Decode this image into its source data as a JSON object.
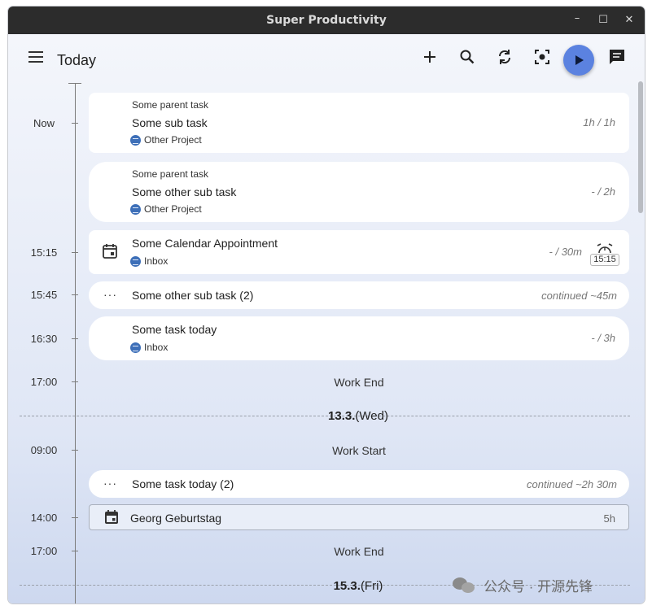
{
  "window": {
    "title": "Super Productivity",
    "minimize": "–",
    "maximize": "☐",
    "close": "✕"
  },
  "toolbar": {
    "title": "Today"
  },
  "timeline": {
    "labels": {
      "now": "Now",
      "t1515": "15:15",
      "t1545": "15:45",
      "t1630": "16:30",
      "t1700": "17:00",
      "t0900": "09:00",
      "t1400": "14:00",
      "t1700b": "17:00"
    },
    "tasks": [
      {
        "parent": "Some parent task",
        "title": "Some sub task",
        "project": "Other Project",
        "estimate": "1h / 1h"
      },
      {
        "parent": "Some parent task",
        "title": "Some other sub task",
        "project": "Other Project",
        "estimate": "- / 2h"
      },
      {
        "title": "Some Calendar Appointment",
        "project": "Inbox",
        "estimate": "- / 30m",
        "alarm": "15:15"
      },
      {
        "title": "Some other sub task (2)",
        "continued": "continued ~45m"
      },
      {
        "title": "Some task today",
        "project": "Inbox",
        "estimate": "- / 3h"
      },
      {
        "title": "Some task today (2)",
        "continued": "continued ~2h 30m"
      },
      {
        "title": "Georg Geburtstag",
        "estimate": "5h"
      }
    ],
    "work_end": "Work End",
    "work_start": "Work Start",
    "work_end_2": "Work End",
    "days": [
      {
        "date": "13.3.",
        "weekday": "(Wed)"
      },
      {
        "date": "15.3.",
        "weekday": "(Fri)"
      }
    ],
    "continuation_dots": "···"
  },
  "watermark": {
    "text": "公众号 · 开源先锋"
  },
  "colors": {
    "accent": "#5b82e0",
    "project_dot": "#3d6fb8",
    "titlebar": "#2c2c2c"
  }
}
